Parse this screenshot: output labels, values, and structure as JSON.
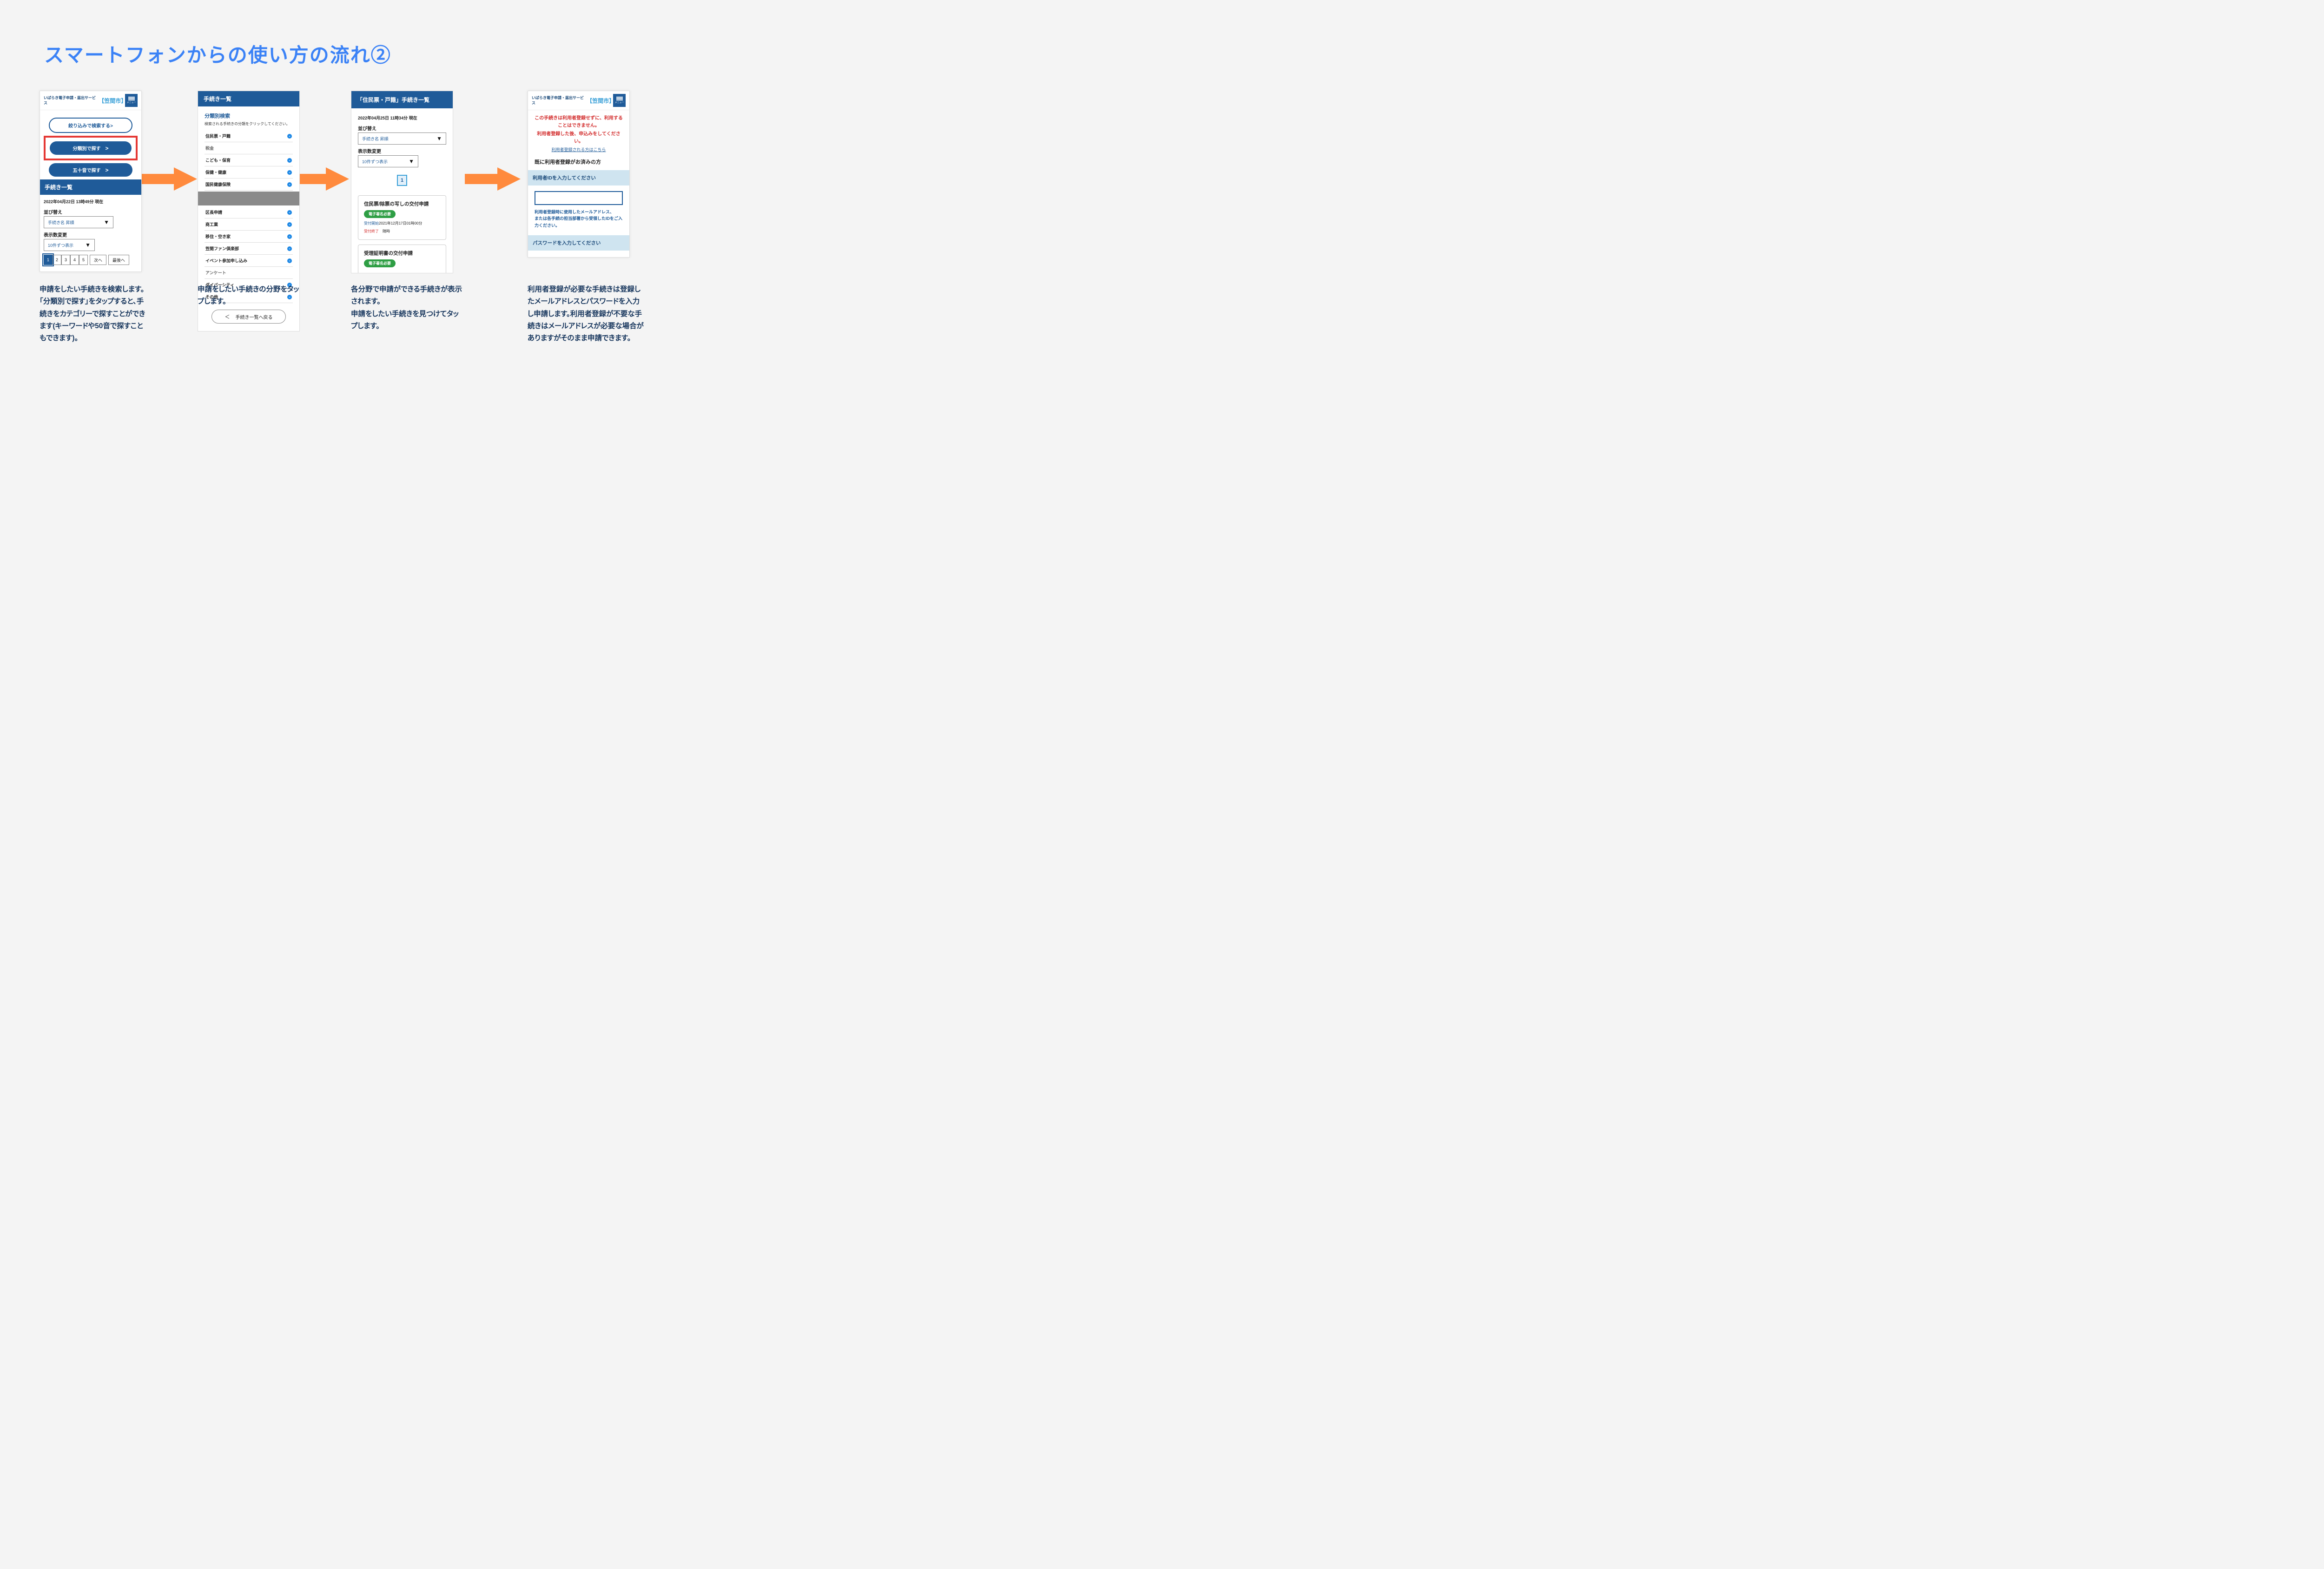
{
  "title": "スマートフォンからの使い方の流れ②",
  "header": {
    "logo": "いばらき電子申請・届出サービス",
    "city": "【笠間市】",
    "menu": "メニュー"
  },
  "phone1": {
    "btn_filter": "絞り込みで検索する>",
    "btn_category": "分類別で探す",
    "btn_50": "五十音で探す",
    "section": "手続き一覧",
    "timestamp": "2022年04月22日 13時49分 現在",
    "sort_lbl": "並び替え",
    "sort_val": "手続き名 昇順",
    "count_lbl": "表示数変更",
    "count_val": "10件ずつ表示",
    "pages": [
      "1",
      "2",
      "3",
      "4",
      "5"
    ],
    "next": "次へ",
    "last": "最後へ"
  },
  "phone2": {
    "top": "手続き一覧",
    "cat_title": "分類別検索",
    "cat_desc": "検索される手続きの分類をクリックしてください。",
    "items_top": [
      "住民票・戸籍",
      "税金",
      "こども・保育",
      "保健・健康",
      "国民健康保険"
    ],
    "items_bottom": [
      "区長申請",
      "商工業",
      "移住・空き家",
      "笠間ファン倶楽部",
      "イベント参加申し込み",
      "アンケート",
      "ダイバーシティ",
      "その他"
    ],
    "back": "手続き一覧へ戻る"
  },
  "phone3": {
    "top": "「住民票・戸籍」手続き一覧",
    "timestamp": "2022年04月25日 11時34分 現在",
    "sort_lbl": "並び替え",
    "sort_val": "手続き名 昇順",
    "count_lbl": "表示数変更",
    "count_val": "10件ずつ表示",
    "page": "1",
    "card1_title": "住民票/除票の写しの交付申請",
    "badge": "電子署名必要",
    "start_lbl": "受付開始",
    "start_val": "2021年12月17日01時00分",
    "end_lbl": "受付終了",
    "end_val": "随時",
    "card2_title": "受理証明書の交付申請"
  },
  "phone4": {
    "warn1": "この手続きは利用者登録せずに、利用することはできません。",
    "warn2": "利用者登録した後、申込みをしてください。",
    "link": "利用者登録される方はこちら",
    "already": "既に利用者登録がお済みの方",
    "id_lbl": "利用者IDを入力してください",
    "hint": "利用者登録時に使用したメールアドレス、\nまたは各手続の担当部署から受領したIDをご入力ください。",
    "pw_lbl": "パスワードを入力してください"
  },
  "captions": {
    "c1": "申請をしたい手続きを検索します。「分類別で探す」をタップすると、手続きをカテゴリーで探すことができます(キーワードや50音で探すこともできます)。",
    "c2": "申請をしたい手続きの分野をタップします。",
    "c3": "各分野で申請ができる手続きが表示されます。\n申請をしたい手続きを見つけてタップします。",
    "c4": "利用者登録が必要な手続きは登録したメールアドレスとパスワードを入力し申請します。利用者登録が不要な手続きはメールアドレスが必要な場合がありますがそのまま申請できます。"
  },
  "chev": ">"
}
